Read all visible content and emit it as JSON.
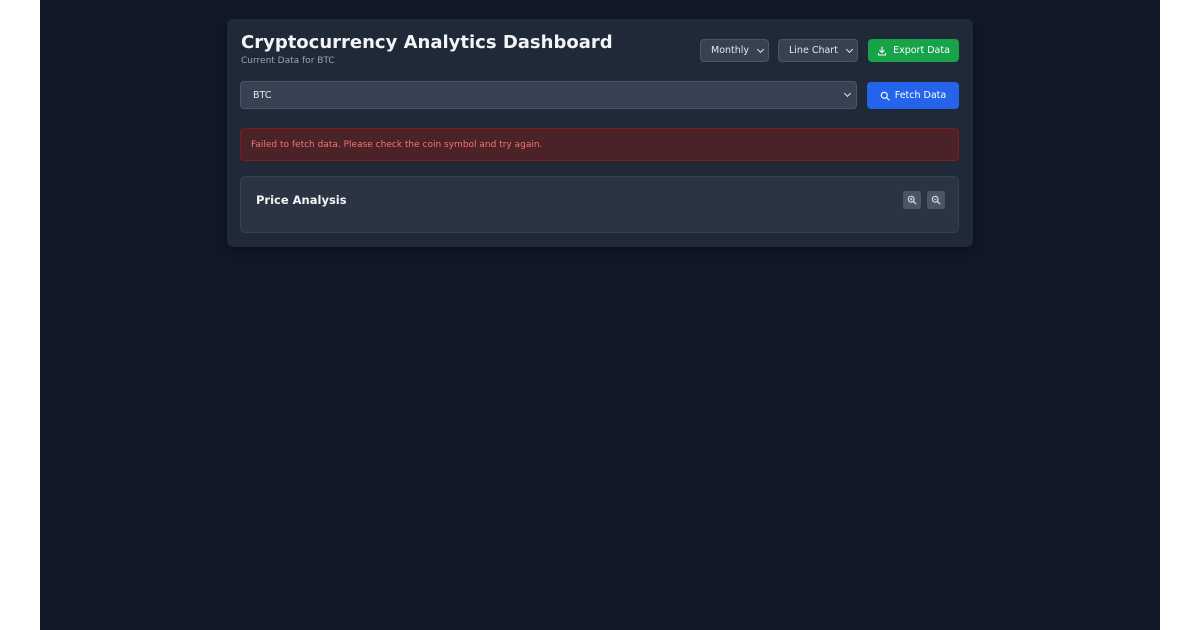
{
  "header": {
    "title": "Cryptocurrency Analytics Dashboard",
    "subtitle": "Current Data for BTC"
  },
  "controls": {
    "period_select": {
      "selected": "Monthly"
    },
    "chart_type_select": {
      "selected": "Line Chart"
    },
    "export_button": {
      "label": "Export Data",
      "icon": "download-icon"
    }
  },
  "search": {
    "coin_select": {
      "selected": "BTC"
    },
    "fetch_button": {
      "label": "Fetch Data",
      "icon": "search-icon"
    }
  },
  "error": {
    "message": "Failed to fetch data. Please check the coin symbol and try again."
  },
  "price_panel": {
    "title": "Price Analysis",
    "zoom_in_icon": "zoom-in-icon",
    "zoom_out_icon": "zoom-out-icon"
  },
  "colors": {
    "background": "#111827",
    "card": "#1f2937",
    "export_green": "#16a34a",
    "fetch_blue": "#2563eb",
    "error_text": "#f87171",
    "error_bg": "#4b2228"
  }
}
